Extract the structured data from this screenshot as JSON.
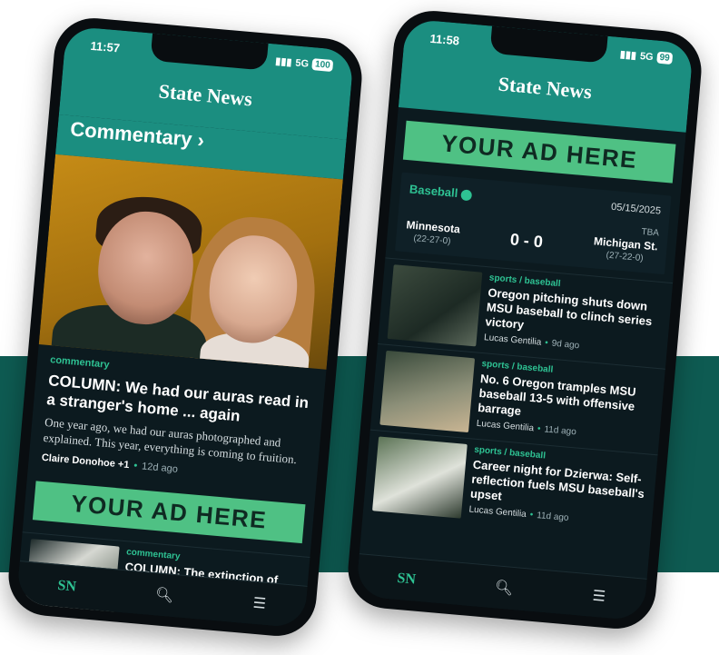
{
  "left_phone": {
    "status": {
      "time": "11:57",
      "network": "5G",
      "battery": "100"
    },
    "logo": "State News",
    "section_title": "Commentary",
    "featured": {
      "kicker": "commentary",
      "title": "COLUMN: We had our auras read in a stranger's home ... again",
      "summary": "One year ago, we had our auras photographed and explained. This year, everything is coming to fruition.",
      "author": "Claire Donohoe +1",
      "ago": "12d ago"
    },
    "ad_text": "YOUR AD HERE",
    "list": [
      {
        "kicker": "commentary",
        "title": "COLUMN: The extinction of the four-year, one-university athlete"
      }
    ],
    "nav": {
      "logo": "SN"
    }
  },
  "right_phone": {
    "status": {
      "time": "11:58",
      "network": "5G",
      "battery": "99"
    },
    "logo": "State News",
    "ad_text": "YOUR AD HERE",
    "score": {
      "sport": "Baseball",
      "date": "05/15/2025",
      "status": "TBA",
      "home": {
        "name": "Minnesota",
        "record": "(22-27-0)"
      },
      "away": {
        "name": "Michigan St.",
        "record": "(27-22-0)"
      },
      "score": "0 - 0"
    },
    "list": [
      {
        "kicker": "sports / baseball",
        "title": "Oregon pitching shuts down MSU baseball to clinch series victory",
        "author": "Lucas Gentilia",
        "ago": "9d ago"
      },
      {
        "kicker": "sports / baseball",
        "title": "No. 6 Oregon tramples MSU baseball 13-5 with offensive barrage",
        "author": "Lucas Gentilia",
        "ago": "11d ago"
      },
      {
        "kicker": "sports / baseball",
        "title": "Career night for Dzierwa: Self-reflection fuels MSU baseball's upset",
        "author": "Lucas Gentilia",
        "ago": "11d ago"
      }
    ],
    "nav": {
      "logo": "SN"
    }
  }
}
